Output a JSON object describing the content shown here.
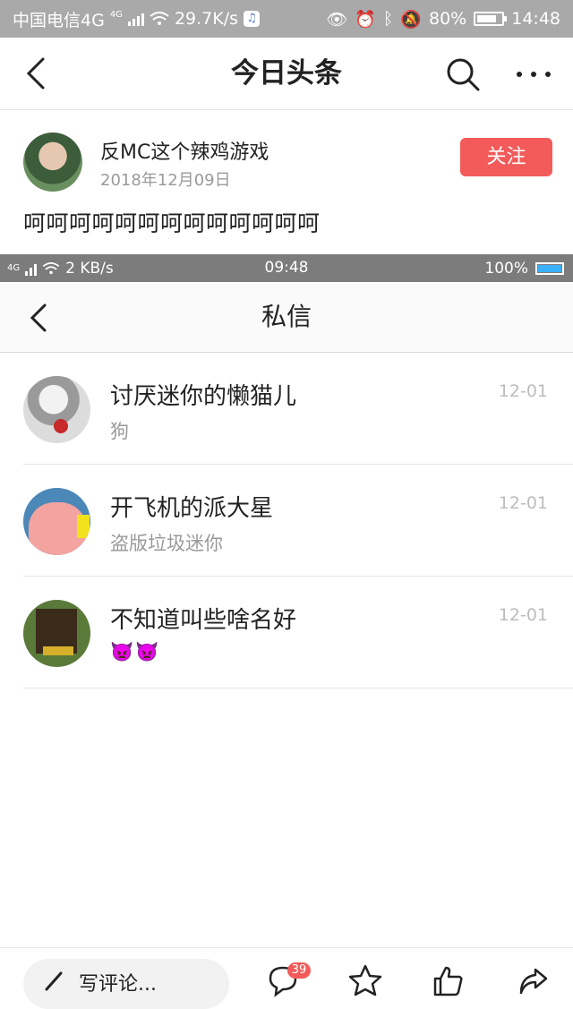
{
  "status_bar_outer": {
    "carrier": "中国电信4G",
    "network_badge": "4G",
    "speed": "29.7K/s",
    "battery": "80%",
    "battery_level": 0.8,
    "time": "14:48"
  },
  "header": {
    "title": "今日头条",
    "icons": [
      "back-icon",
      "search-icon",
      "more-icon"
    ]
  },
  "author": {
    "name": "反MC这个辣鸡游戏",
    "date": "2018年12月09日",
    "follow_label": "关注"
  },
  "post": {
    "text": "呵呵呵呵呵呵呵呵呵呵呵呵呵"
  },
  "status_bar_inner": {
    "network": "4G",
    "speed": "2 KB/s",
    "time": "09:48",
    "battery": "100%",
    "battery_level": 1.0
  },
  "messages": {
    "title": "私信",
    "conversations": [
      {
        "name": "讨厌迷你的懒猫儿",
        "preview": "狗",
        "time": "12-01"
      },
      {
        "name": "开飞机的派大星",
        "preview": "盗版垃圾迷你",
        "time": "12-01"
      },
      {
        "name": "不知道叫些啥名好",
        "preview": "👿👿",
        "time": "12-01"
      }
    ]
  },
  "bottom_bar": {
    "comment_placeholder": "写评论...",
    "comment_count": "39",
    "icons": [
      "pen-icon",
      "comment-icon",
      "star-icon",
      "like-icon",
      "share-icon"
    ]
  },
  "colors": {
    "accent": "#f35b5b",
    "outer_status_bg": "#a9a9a9",
    "inner_status_bg": "#7c7c7c"
  }
}
